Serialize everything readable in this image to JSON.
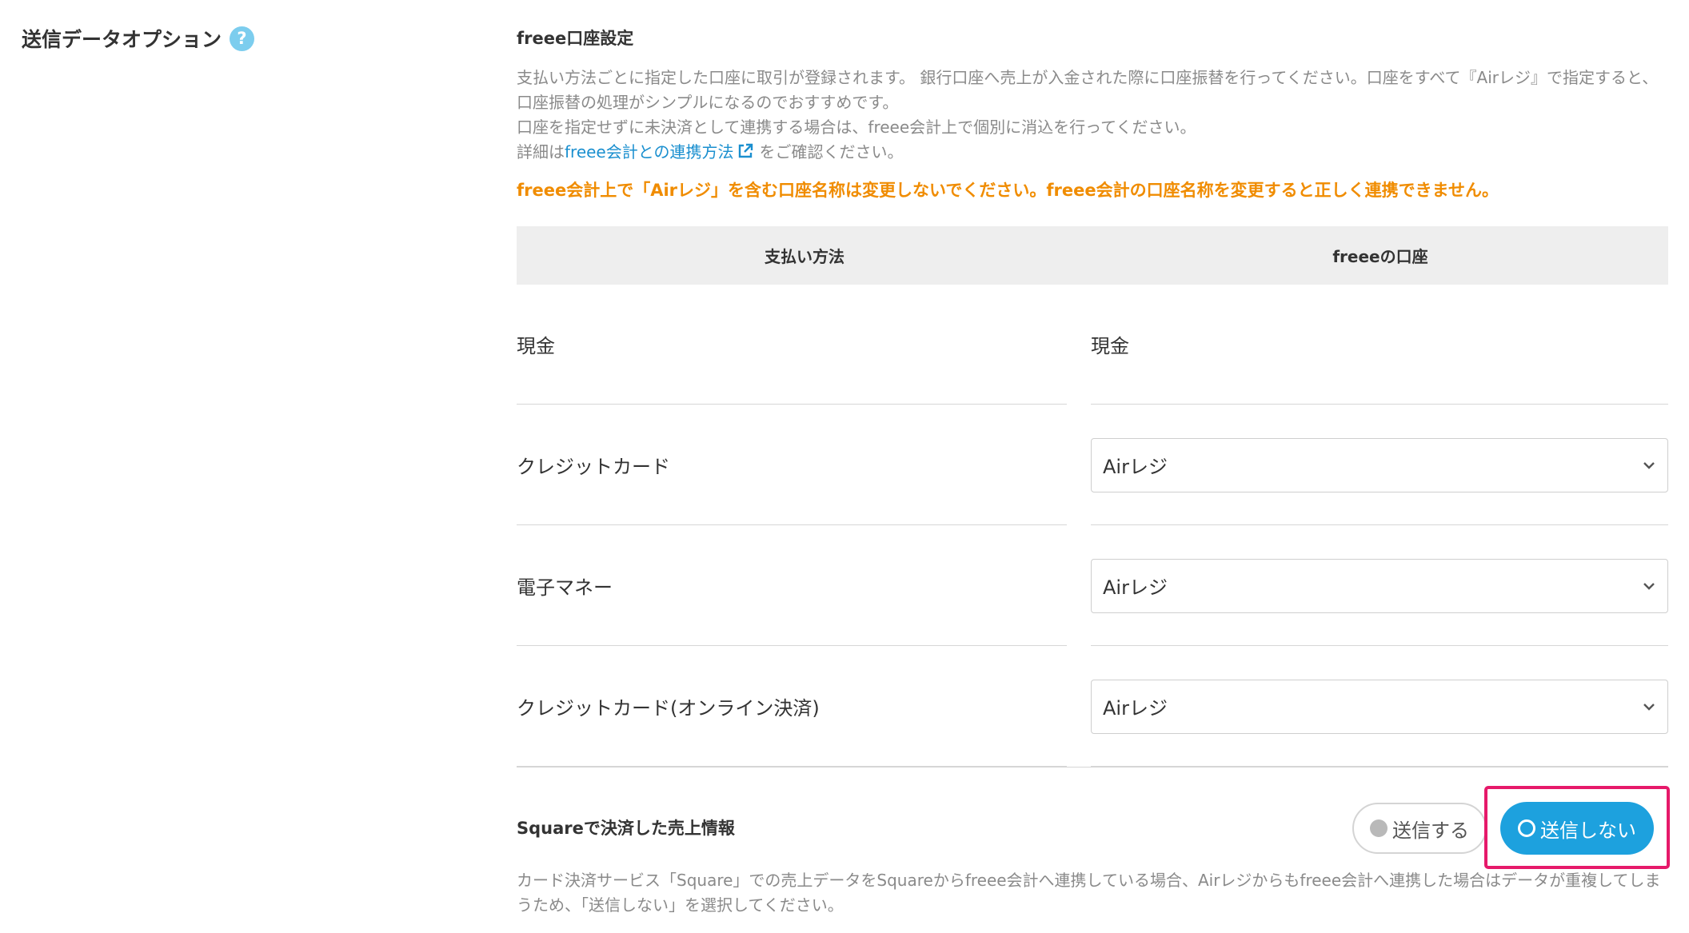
{
  "section": {
    "label": "送信データオプション",
    "help_icon": "question-circle-icon"
  },
  "freee_account": {
    "title": "freee口座設定",
    "desc_line1": "支払い方法ごとに指定した口座に取引が登録されます。 銀行口座へ売上が入金された際に口座振替を行ってください。口座をすべて『Airレジ』で指定すると、口座振替の処理がシンプルになるのでおすすめです。",
    "desc_line2": "口座を指定せずに未決済として連携する場合は、freee会計上で個別に消込を行ってください。",
    "desc_line3_prefix": "詳細は",
    "desc_link": "freee会計との連携方法",
    "desc_line3_suffix": "をご確認ください。",
    "warning": "freee会計上で「Airレジ」を含む口座名称は変更しないでください。freee会計の口座名称を変更すると正しく連携できません。"
  },
  "table": {
    "headers": [
      "支払い方法",
      "freeeの口座"
    ],
    "rows": [
      {
        "method": "現金",
        "account": "現金",
        "type": "text"
      },
      {
        "method": "クレジットカード",
        "account": "Airレジ",
        "type": "select"
      },
      {
        "method": "電子マネー",
        "account": "Airレジ",
        "type": "select"
      },
      {
        "method": "クレジットカード(オンライン決済)",
        "account": "Airレジ",
        "type": "select"
      }
    ]
  },
  "square": {
    "title": "Squareで決済した売上情報",
    "option_send": "送信する",
    "option_nosend": "送信しない",
    "selected": "送信しない",
    "desc": "カード決済サービス「Square」での売上データをSquareからfreee会計へ連携している場合、Airレジからもfreee会計へ連携した場合はデータが重複してしまうため、「送信しない」を選択してください。"
  },
  "colors": {
    "accent": "#1da1de",
    "warning": "#f08c00",
    "highlight": "#e6196a",
    "link": "#1a8fcf"
  }
}
